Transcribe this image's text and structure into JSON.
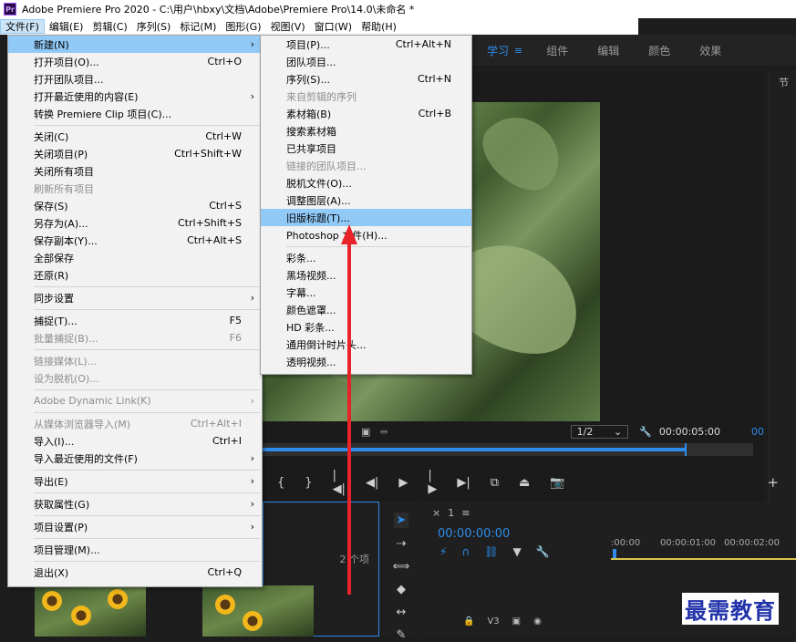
{
  "window": {
    "title": "Adobe Premiere Pro 2020 - C:\\用户\\hbxy\\文档\\Adobe\\Premiere Pro\\14.0\\未命名 *",
    "app_icon": "Pr"
  },
  "menubar": [
    "文件(F)",
    "编辑(E)",
    "剪辑(C)",
    "序列(S)",
    "标记(M)",
    "图形(G)",
    "视图(V)",
    "窗口(W)",
    "帮助(H)"
  ],
  "workspaces": {
    "learn": "学习",
    "menu_icon": "≡",
    "assembly": "组件",
    "editing": "编辑",
    "color": "颜色",
    "effects": "效果"
  },
  "right_panel_label": "节",
  "file_menu": [
    {
      "label": "新建(N)",
      "shortcut": "",
      "submenu": true,
      "state": "highlight"
    },
    {
      "label": "打开项目(O)...",
      "shortcut": "Ctrl+O"
    },
    {
      "label": "打开团队项目...",
      "shortcut": ""
    },
    {
      "label": "打开最近使用的内容(E)",
      "shortcut": "",
      "submenu": true
    },
    {
      "label": "转换 Premiere Clip 项目(C)...",
      "shortcut": ""
    },
    {
      "sep": true
    },
    {
      "label": "关闭(C)",
      "shortcut": "Ctrl+W"
    },
    {
      "label": "关闭项目(P)",
      "shortcut": "Ctrl+Shift+W"
    },
    {
      "label": "关闭所有项目",
      "shortcut": ""
    },
    {
      "label": "刷新所有项目",
      "shortcut": "",
      "state": "disabled"
    },
    {
      "label": "保存(S)",
      "shortcut": "Ctrl+S"
    },
    {
      "label": "另存为(A)...",
      "shortcut": "Ctrl+Shift+S"
    },
    {
      "label": "保存副本(Y)...",
      "shortcut": "Ctrl+Alt+S"
    },
    {
      "label": "全部保存",
      "shortcut": ""
    },
    {
      "label": "还原(R)",
      "shortcut": ""
    },
    {
      "sep": true
    },
    {
      "label": "同步设置",
      "shortcut": "",
      "submenu": true
    },
    {
      "sep": true
    },
    {
      "label": "捕捉(T)...",
      "shortcut": "F5"
    },
    {
      "label": "批量捕捉(B)...",
      "shortcut": "F6",
      "state": "disabled"
    },
    {
      "sep": true
    },
    {
      "label": "链接媒体(L)...",
      "shortcut": "",
      "state": "disabled"
    },
    {
      "label": "设为脱机(O)...",
      "shortcut": "",
      "state": "disabled"
    },
    {
      "sep": true
    },
    {
      "label": "Adobe Dynamic Link(K)",
      "shortcut": "",
      "submenu": true,
      "state": "disabled"
    },
    {
      "sep": true
    },
    {
      "label": "从媒体浏览器导入(M)",
      "shortcut": "Ctrl+Alt+I",
      "state": "disabled"
    },
    {
      "label": "导入(I)...",
      "shortcut": "Ctrl+I"
    },
    {
      "label": "导入最近使用的文件(F)",
      "shortcut": "",
      "submenu": true
    },
    {
      "sep": true
    },
    {
      "label": "导出(E)",
      "shortcut": "",
      "submenu": true
    },
    {
      "sep": true
    },
    {
      "label": "获取属性(G)",
      "shortcut": "",
      "submenu": true
    },
    {
      "sep": true
    },
    {
      "label": "项目设置(P)",
      "shortcut": "",
      "submenu": true
    },
    {
      "sep": true
    },
    {
      "label": "项目管理(M)...",
      "shortcut": ""
    },
    {
      "sep": true
    },
    {
      "label": "退出(X)",
      "shortcut": "Ctrl+Q"
    }
  ],
  "new_submenu": [
    {
      "label": "项目(P)...",
      "shortcut": "Ctrl+Alt+N"
    },
    {
      "label": "团队项目...",
      "shortcut": ""
    },
    {
      "label": "序列(S)...",
      "shortcut": "Ctrl+N"
    },
    {
      "label": "来自剪辑的序列",
      "shortcut": "",
      "state": "disabled"
    },
    {
      "label": "素材箱(B)",
      "shortcut": "Ctrl+B"
    },
    {
      "label": "搜索素材箱",
      "shortcut": ""
    },
    {
      "label": "已共享项目",
      "shortcut": ""
    },
    {
      "label": "链接的团队项目...",
      "shortcut": "",
      "state": "disabled"
    },
    {
      "label": "脱机文件(O)...",
      "shortcut": ""
    },
    {
      "label": "调整图层(A)...",
      "shortcut": ""
    },
    {
      "label": "旧版标题(T)...",
      "shortcut": "",
      "state": "highlight"
    },
    {
      "label": "Photoshop 文件(H)...",
      "shortcut": ""
    },
    {
      "sep": true
    },
    {
      "label": "彩条...",
      "shortcut": ""
    },
    {
      "label": "黑场视频...",
      "shortcut": ""
    },
    {
      "label": "字幕...",
      "shortcut": ""
    },
    {
      "label": "颜色遮罩...",
      "shortcut": ""
    },
    {
      "label": "HD 彩条...",
      "shortcut": ""
    },
    {
      "label": "通用倒计时片头...",
      "shortcut": ""
    },
    {
      "label": "透明视频...",
      "shortcut": ""
    }
  ],
  "program_monitor": {
    "resolution": "1/2",
    "resolution_caret": "⌄",
    "wrench_icon": "🔧",
    "timecode": "00:00:05:00",
    "side_timecode": "00",
    "playhead_fraction": 0.86
  },
  "transport": [
    "{",
    "}",
    "|◀|",
    "◀|",
    "▶",
    "|▶",
    "▶|",
    "⧉",
    "⏏",
    "📷"
  ],
  "transport_plus": "+",
  "project_panel": {
    "count_label": "2 个项"
  },
  "timeline": {
    "tab_close": "×",
    "sequence_tab": "1",
    "tab_menu": "≡",
    "timecode": "00:00:00:00",
    "ruler": [
      ":00:00",
      "00:00:01:00",
      "00:00:02:00"
    ],
    "track_label": "V3"
  },
  "watermark": "最需教育",
  "colors": {
    "accent": "#2d8ceb",
    "menu_highlight": "#91c9f7",
    "arrow": "#e8232a"
  }
}
